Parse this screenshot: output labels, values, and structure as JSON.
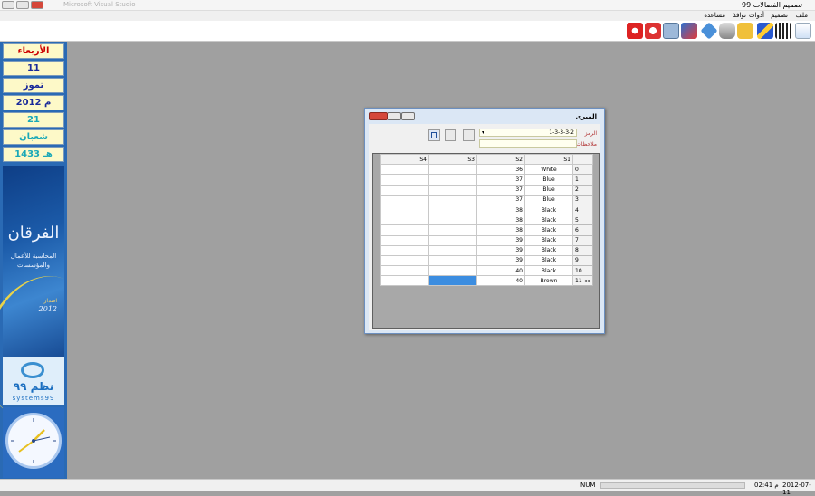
{
  "window": {
    "title": "تصميم الفصالات 99",
    "ghost_title": "Microsoft Visual Studio"
  },
  "menu": {
    "items": [
      "ملف",
      "تصميم",
      "أدوات",
      "نوافذ",
      "مساعدة"
    ]
  },
  "toolbar": {
    "icons": [
      "new-icon",
      "barcode-icon",
      "brush-icon",
      "lock-icon",
      "database-icon",
      "diamond-icon",
      "card-icon",
      "calculator-icon",
      "search-icon",
      "power-icon"
    ]
  },
  "sidebar": {
    "day_name": "الأربعاء",
    "day": "11",
    "month": "تموز",
    "year": "2012 م",
    "hijri_day": "21",
    "hijri_month": "شعبان",
    "hijri_year": "1433 هـ",
    "logo_title": "الفرقان",
    "logo_subtitle1": "المحاسبة للأعمال",
    "logo_subtitle2": "والمؤسسات",
    "version_label": "اصدار",
    "version_year": "2012",
    "company_logo": "نظم ٩٩",
    "company_latin": "systems99",
    "colors": {
      "day_name": "#cc0000",
      "gregorian": "#1a2a9a",
      "hijri": "#1aa8b8"
    }
  },
  "dialog": {
    "title": "المبرى",
    "code_label": "الرمز",
    "code_value": "1-3-3-3-2",
    "notes_label": "ملاحظات",
    "notes_value": "",
    "columns": [
      "",
      "S1",
      "S2",
      "S3",
      "S4"
    ],
    "rows": [
      {
        "idx": "0",
        "s1": "White",
        "s2": "36",
        "s3": "",
        "s4": ""
      },
      {
        "idx": "1",
        "s1": "Blue",
        "s2": "37",
        "s3": "",
        "s4": ""
      },
      {
        "idx": "2",
        "s1": "Blue",
        "s2": "37",
        "s3": "",
        "s4": ""
      },
      {
        "idx": "3",
        "s1": "Blue",
        "s2": "37",
        "s3": "",
        "s4": ""
      },
      {
        "idx": "4",
        "s1": "Black",
        "s2": "38",
        "s3": "",
        "s4": ""
      },
      {
        "idx": "5",
        "s1": "Black",
        "s2": "38",
        "s3": "",
        "s4": ""
      },
      {
        "idx": "6",
        "s1": "Black",
        "s2": "38",
        "s3": "",
        "s4": ""
      },
      {
        "idx": "7",
        "s1": "Black",
        "s2": "39",
        "s3": "",
        "s4": ""
      },
      {
        "idx": "8",
        "s1": "Black",
        "s2": "39",
        "s3": "",
        "s4": ""
      },
      {
        "idx": "9",
        "s1": "Black",
        "s2": "39",
        "s3": "",
        "s4": ""
      },
      {
        "idx": "10",
        "s1": "Black",
        "s2": "40",
        "s3": "",
        "s4": ""
      },
      {
        "idx": "11",
        "s1": "Brown",
        "s2": "40",
        "s3": "",
        "s4": "",
        "current_marker": "◂◂"
      }
    ]
  },
  "status": {
    "num": "NUM",
    "time": "02:41 م",
    "date": "2012-07-11"
  }
}
